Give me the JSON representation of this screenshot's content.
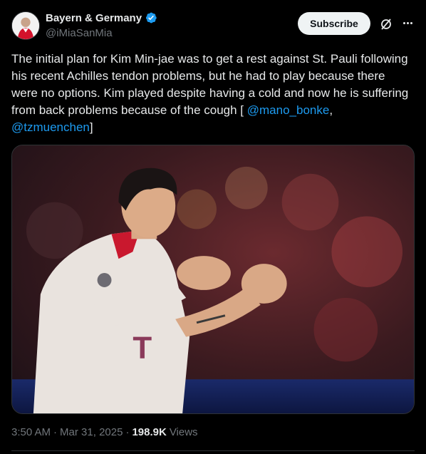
{
  "author": {
    "display_name": "Bayern & Germany",
    "handle": "@iMiaSanMia",
    "verified": true
  },
  "actions": {
    "subscribe_label": "Subscribe",
    "grok_icon": "grok-icon",
    "more_icon": "more-icon"
  },
  "tweet": {
    "text_main": "The initial plan for Kim Min-jae was to get a rest against St. Pauli following his recent Achilles tendon problems, but he had to play because there were no options. Kim played despite having a cold and now he is suffering from back problems because of the cough [",
    "mention_1": "@mano_bonke",
    "separator": ", ",
    "mention_2": "@tzmuenchen",
    "closing": "]"
  },
  "meta": {
    "time": "3:50 AM",
    "dot_1": "·",
    "date": "Mar 31, 2025",
    "dot_2": "·",
    "views_count": "198.9K",
    "views_label": "Views"
  },
  "colors": {
    "background": "#000000",
    "text": "#e7e9ea",
    "muted": "#71767b",
    "link": "#1d9bf0",
    "verified": "#1d9bf0"
  }
}
